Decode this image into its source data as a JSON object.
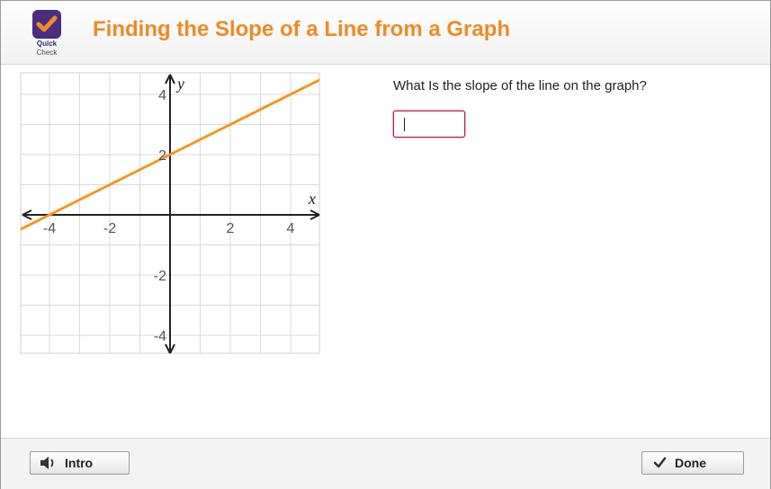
{
  "header": {
    "title": "Finding the Slope of a Line from a Graph",
    "logo": {
      "line1": "Quick",
      "line2": "Check",
      "icon": "checkmark-icon",
      "color": "#4a2d82",
      "accent": "#f08a24"
    }
  },
  "graph": {
    "x_axis_label": "x",
    "y_axis_label": "y",
    "x_ticks": [
      "-4",
      "-2",
      "2",
      "4"
    ],
    "y_ticks": [
      "4",
      "2",
      "-2",
      "-4"
    ],
    "line_color": "#f7941d",
    "line": {
      "x_intercept": -4,
      "y_intercept": 2
    }
  },
  "question": {
    "text": "What Is the slope of the line on the graph?",
    "answer_value": ""
  },
  "footer": {
    "intro_label": "Intro",
    "intro_icon": "speaker-icon",
    "done_label": "Done",
    "done_icon": "checkmark-icon"
  }
}
